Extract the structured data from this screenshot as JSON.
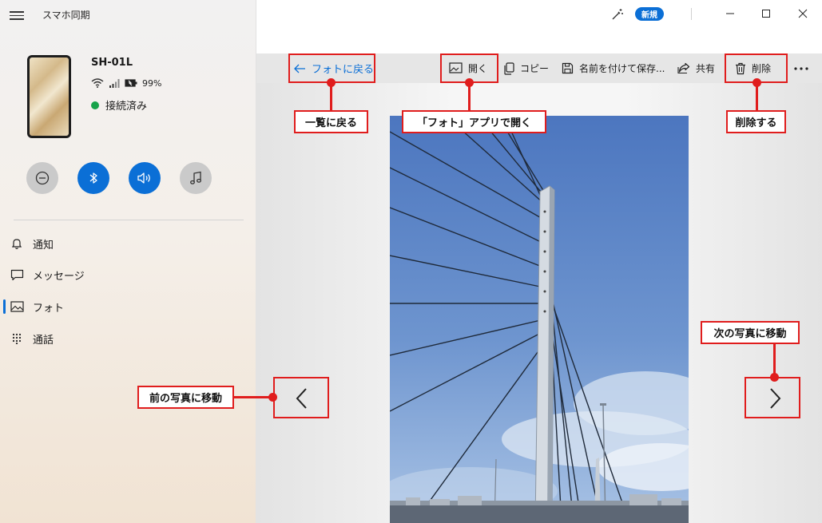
{
  "app": {
    "title": "スマホ同期",
    "new_badge": "新規"
  },
  "device": {
    "name": "SH-01L",
    "battery": "99%",
    "connection": "接続済み"
  },
  "quick_actions": [
    {
      "icon": "do-not-disturb-icon",
      "state": "off"
    },
    {
      "icon": "bluetooth-icon",
      "state": "on"
    },
    {
      "icon": "volume-icon",
      "state": "on"
    },
    {
      "icon": "music-icon",
      "state": "off"
    }
  ],
  "nav": {
    "items": [
      {
        "label": "通知",
        "icon": "bell-icon"
      },
      {
        "label": "メッセージ",
        "icon": "message-icon"
      },
      {
        "label": "フォト",
        "icon": "photo-icon",
        "selected": true
      },
      {
        "label": "通話",
        "icon": "dialpad-icon"
      }
    ]
  },
  "toolbar": {
    "back": "フォトに戻る",
    "open": "開く",
    "copy": "コピー",
    "save_as": "名前を付けて保存...",
    "share": "共有",
    "delete": "削除"
  },
  "annotations": {
    "back": "一覧に戻る",
    "open": "「フォト」アプリで開く",
    "delete": "削除する",
    "next": "次の写真に移動",
    "prev": "前の写真に移動"
  },
  "colors": {
    "accent": "#0b6fd6",
    "connected": "#16a34a",
    "annotation": "#e01d1d",
    "sky": "#5e87c5"
  }
}
